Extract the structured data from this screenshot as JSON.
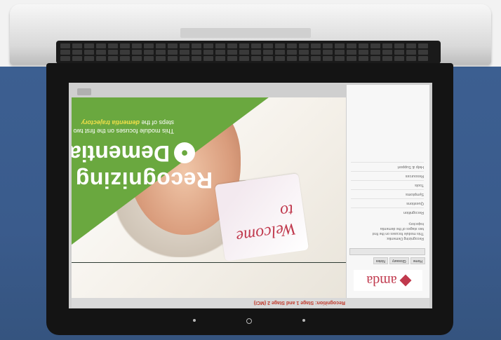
{
  "course": {
    "title": "Recognition: Stage 1 and Stage 2 (MCI)"
  },
  "brand": {
    "name": "amda"
  },
  "sidebar": {
    "tabs": [
      {
        "label": "Home"
      },
      {
        "label": "Glossary"
      },
      {
        "label": "Notes"
      }
    ],
    "description": [
      "Recognizing Dementia:",
      "This module focuses on the first",
      "two stages of the dementia",
      "trajectory."
    ],
    "menu": [
      {
        "label": "Recognition"
      },
      {
        "label": "Questions"
      },
      {
        "label": "Symptoms"
      },
      {
        "label": "Tools"
      },
      {
        "label": "Resources"
      },
      {
        "label": "Help & Support"
      }
    ]
  },
  "slide": {
    "welcome": "Welcome to",
    "title_line1": "Recognizing",
    "title_line2": "Dementia",
    "subtitle_pre": "This module focuses on the first two",
    "subtitle_mid": "steps of the",
    "subtitle_highlight": "dementia trajectory"
  },
  "colors": {
    "accent_green": "#6aa83f",
    "brand_red": "#c0394d",
    "highlight_yellow": "#f1e04a"
  },
  "icons": {
    "logo": "amda-diamond-icon",
    "brain": "brain-icon"
  }
}
